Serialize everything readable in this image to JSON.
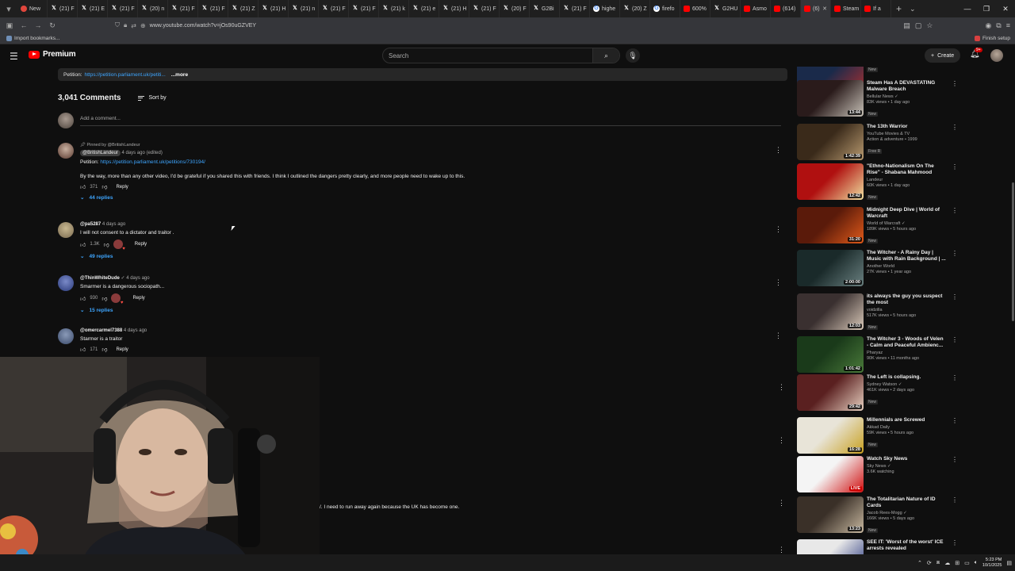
{
  "browser": {
    "tabs": [
      {
        "label": "New",
        "icon": "app-icon",
        "color": "#e0463c"
      },
      {
        "label": "(21) F",
        "icon": "x-icon",
        "color": "#ffffff"
      },
      {
        "label": "(21) E",
        "icon": "x-icon",
        "color": "#ffffff"
      },
      {
        "label": "(21) F",
        "icon": "x-icon",
        "color": "#ffffff"
      },
      {
        "label": "(20) n",
        "icon": "x-icon",
        "color": "#ffffff"
      },
      {
        "label": "(21) F",
        "icon": "x-icon",
        "color": "#ffffff"
      },
      {
        "label": "(21) F",
        "icon": "x-icon",
        "color": "#ffffff"
      },
      {
        "label": "(21) Z",
        "icon": "x-icon",
        "color": "#ffffff"
      },
      {
        "label": "(21) H",
        "icon": "x-icon",
        "color": "#ffffff"
      },
      {
        "label": "(21) n",
        "icon": "x-icon",
        "color": "#ffffff"
      },
      {
        "label": "(21) F",
        "icon": "x-icon",
        "color": "#ffffff"
      },
      {
        "label": "(21) F",
        "icon": "x-icon",
        "color": "#ffffff"
      },
      {
        "label": "(21) k",
        "icon": "x-icon",
        "color": "#ffffff"
      },
      {
        "label": "(21) e",
        "icon": "x-icon",
        "color": "#ffffff"
      },
      {
        "label": "(21) H",
        "icon": "x-icon",
        "color": "#ffffff"
      },
      {
        "label": "(21) F",
        "icon": "x-icon",
        "color": "#ffffff"
      },
      {
        "label": "(20) F",
        "icon": "x-icon",
        "color": "#ffffff"
      },
      {
        "label": "G2Bi",
        "icon": "x-icon",
        "color": "#ffffff"
      },
      {
        "label": "(21) F",
        "icon": "x-icon",
        "color": "#ffffff"
      },
      {
        "label": "highe",
        "icon": "google-icon",
        "color": "#ffffff"
      },
      {
        "label": "(20) Z",
        "icon": "x-icon",
        "color": "#ffffff"
      },
      {
        "label": "firefo",
        "icon": "google-icon",
        "color": "#ffffff"
      },
      {
        "label": "600%",
        "icon": "youtube-icon",
        "color": "#ff0000"
      },
      {
        "label": "G2HU",
        "icon": "x-icon",
        "color": "#ffffff"
      },
      {
        "label": "Asmo",
        "icon": "youtube-icon",
        "color": "#ff0000"
      },
      {
        "label": "(614)",
        "icon": "youtube-icon",
        "color": "#ff0000"
      },
      {
        "label": "(6)",
        "icon": "youtube-icon",
        "color": "#ff0000",
        "active": true
      },
      {
        "label": "Steam",
        "icon": "youtube-icon",
        "color": "#ff0000"
      },
      {
        "label": "If a",
        "icon": "youtube-icon",
        "color": "#ff0000"
      }
    ],
    "url": "www.youtube.com/watch?v=jOs90uGZVEY",
    "bookmarks_left": "Import bookmarks...",
    "bookmarks_right": "Finish setup"
  },
  "header": {
    "logo_text": "Premium",
    "search_placeholder": "Search",
    "create_label": "Create",
    "notif_badge": "9+"
  },
  "description": {
    "prefix": "Petition:",
    "link": "https://petition.parliament.uk/petiti...",
    "more": "...more"
  },
  "comments_section": {
    "count_label": "3,041 Comments",
    "sort_label": "Sort by",
    "add_placeholder": "Add a comment..."
  },
  "comments": [
    {
      "pinned_label": "Pinned by @BritishLandeur",
      "handle": "@BritishLandeur",
      "time": "4 days ago (edited)",
      "line1_prefix": "Petition:",
      "line1_link": "https://petition.parliament.uk/petitions/730194/",
      "line2": "By the way, more than any other video, I'd be grateful if you shared this with friends. I think I outlined the dangers pretty clearly, and more people need to wake up to this.",
      "likes": "371",
      "reply_label": "Reply",
      "replies_label": "44 replies"
    },
    {
      "handle": "@pa5287",
      "time": "4 days ago",
      "text": "I will not consent to a dictator and traitor .",
      "likes": "1.3K",
      "reply_label": "Reply",
      "replies_label": "49 replies"
    },
    {
      "handle": "@ThinWhiteDude",
      "time": "4 days ago",
      "text": "Smarmer is a dangerous sociopath...",
      "likes": "930",
      "reply_label": "Reply",
      "replies_label": "15 replies"
    },
    {
      "handle": "@omercarmel7388",
      "time": "4 days ago",
      "text": "Starmer is a traitor",
      "likes": "171",
      "reply_label": "Reply"
    }
  ],
  "stray_comment_text": "/. I need to run away again because the UK has become one.",
  "sidebar": [
    {
      "title": "",
      "channel": "",
      "stats": "",
      "tag": "New",
      "duration": "12:18",
      "thumb": [
        "#1a2a4a",
        "#b03030"
      ]
    },
    {
      "title": "Steam Has A DEVASTATING Malware Breach",
      "channel": "Bellular News ✓",
      "stats": "83K views • 1 day ago",
      "tag": "New",
      "duration": "13:44",
      "thumb": [
        "#2a1b1b",
        "#c8c2b8"
      ]
    },
    {
      "title": "The 13th Warrior",
      "channel": "YouTube Movies & TV",
      "stats": "Action & adventure • 1999",
      "tag": "Free  R",
      "duration": "1:42:39",
      "thumb": [
        "#3a2a1a",
        "#b89a70"
      ]
    },
    {
      "title": "\"Ethno-Nationalism On The Rise\" - Shabana Mahmood",
      "channel": "Landeur",
      "stats": "60K views • 1 day ago",
      "tag": "New",
      "duration": "12:42",
      "thumb": [
        "#b01010",
        "#f0e0a0"
      ]
    },
    {
      "title": "Midnight Deep Dive | World of Warcraft",
      "channel": "World of Warcraft ✓",
      "stats": "189K views • 5 hours ago",
      "tag": "New",
      "duration": "31:20",
      "thumb": [
        "#5a1a0a",
        "#e05a1a"
      ]
    },
    {
      "title": "The Witcher - A Rainy Day | Music with Rain Background | ...",
      "channel": "Another World",
      "stats": "27K views • 1 year ago",
      "tag": "",
      "duration": "2:00:00",
      "thumb": [
        "#1a2a2a",
        "#6a8080"
      ]
    },
    {
      "title": "its always the guy you suspect the most",
      "channel": "voidzilla",
      "stats": "517K views • 5 hours ago",
      "tag": "New",
      "duration": "12:03",
      "thumb": [
        "#3a3030",
        "#d8c8b8"
      ]
    },
    {
      "title": "The Witcher 3 - Woods of Velen - Calm and Peaceful Ambienc...",
      "channel": "Pharyaz",
      "stats": "90K views • 11 months ago",
      "tag": "",
      "duration": "1:01:42",
      "thumb": [
        "#1a3a1a",
        "#4a7a3a"
      ]
    },
    {
      "title": "The Left is collapsing.",
      "channel": "Sydney Watson ✓",
      "stats": "461K views • 2 days ago",
      "tag": "New",
      "duration": "29:42",
      "thumb": [
        "#5a2020",
        "#e8d0c0"
      ]
    },
    {
      "title": "Millennials are Screwed",
      "channel": "Akkad Daily",
      "stats": "59K views • 5 hours ago",
      "tag": "New",
      "duration": "16:28",
      "thumb": [
        "#e8e4d8",
        "#c8a020"
      ]
    },
    {
      "title": "Watch Sky News",
      "channel": "Sky News ✓",
      "stats": "3.6K watching",
      "tag": "",
      "duration": "LIVE",
      "thumb": [
        "#f4f4f4",
        "#d01010"
      ]
    },
    {
      "title": "The Totalitarian Nature of ID Cards",
      "channel": "Jacob Rees-Mogg ✓",
      "stats": "166K views • 5 days ago",
      "tag": "New",
      "duration": "13:23",
      "thumb": [
        "#3a3028",
        "#c8b8a0"
      ]
    },
    {
      "title": "SEE IT: 'Worst of the worst' ICE arrests revealed",
      "channel": "",
      "stats": "",
      "tag": "",
      "duration": "",
      "thumb": [
        "#e8e8e8",
        "#20307a"
      ]
    }
  ],
  "taskbar": {
    "time": "5:23 PM",
    "date": "10/1/2025"
  }
}
